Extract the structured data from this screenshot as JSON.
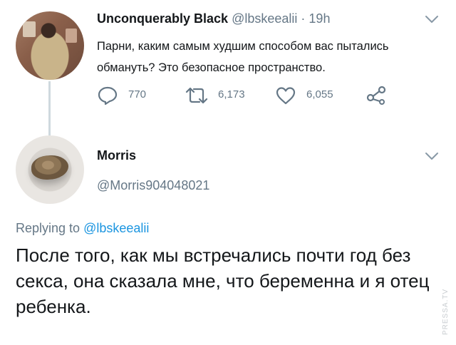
{
  "tweet1": {
    "author_name": "Unconquerably Black",
    "handle": "@lbskeealii",
    "separator": "·",
    "time": "19h",
    "text": "Парни, каким самым худшим способом вас пытались обмануть? Это безопасное пространство.",
    "replies": "770",
    "retweets": "6,173",
    "likes": "6,055"
  },
  "tweet2": {
    "author_name": "Morris",
    "handle": "@Morris904048021",
    "replying_prefix": "Replying to",
    "replying_to": "@lbskeealii",
    "text": "После того, как мы встречались почти год без секса, она сказала мне, что беременна и я отец ребенка."
  },
  "watermark": "PRESSA.TV",
  "icons": [
    "reply-icon",
    "retweet-icon",
    "like-icon",
    "share-icon",
    "chevron-down-icon"
  ],
  "colors": {
    "link": "#1b95e0",
    "secondary": "#657786",
    "icon": "#657786",
    "thread_line": "#cfd9de"
  }
}
